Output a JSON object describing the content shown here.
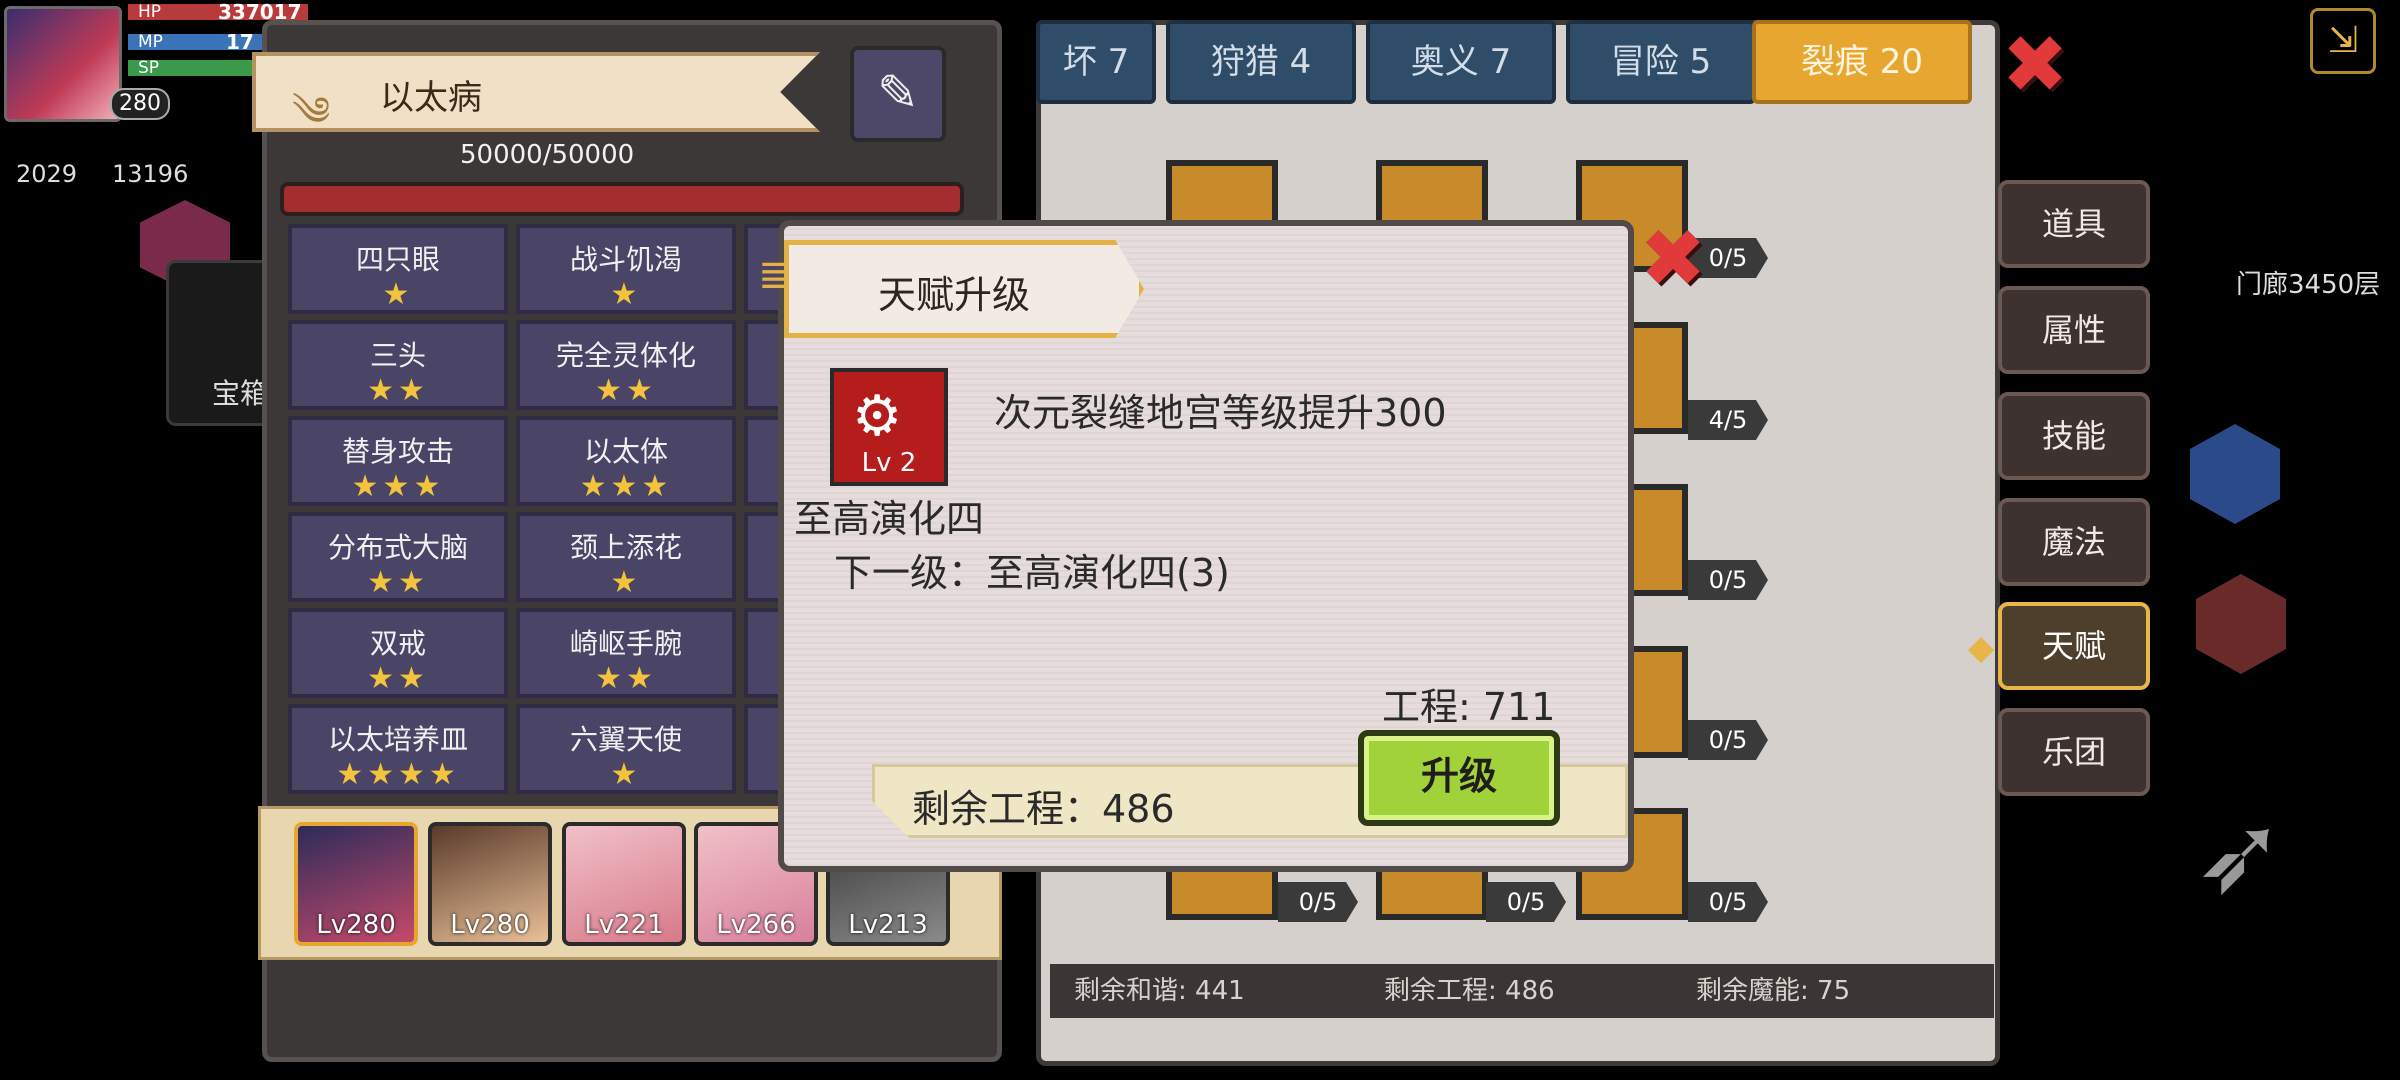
{
  "player": {
    "level": "280",
    "hp": "337017",
    "mp": "17",
    "sp": "",
    "stat1": "2029",
    "stat2": "13196"
  },
  "left_panel": {
    "title": "以太病",
    "hp_text": "50000/50000",
    "traits": [
      {
        "name": "四只眼",
        "stars": "★"
      },
      {
        "name": "战斗饥渴",
        "stars": "★"
      },
      {
        "name": "三头",
        "stars": "★★"
      },
      {
        "name": "完全灵体化",
        "stars": "★★"
      },
      {
        "name": "替身攻击",
        "stars": "★★★"
      },
      {
        "name": "以太体",
        "stars": "★★★"
      },
      {
        "name": "分布式大脑",
        "stars": "★★"
      },
      {
        "name": "颈上添花",
        "stars": "★"
      },
      {
        "name": "双戒",
        "stars": "★★"
      },
      {
        "name": "崎岖手腕",
        "stars": "★★"
      },
      {
        "name": "以太培养皿",
        "stars": "★★★★"
      },
      {
        "name": "六翼天使",
        "stars": "★"
      }
    ],
    "characters": [
      {
        "lv": "Lv280"
      },
      {
        "lv": "Lv280"
      },
      {
        "lv": "Lv221"
      },
      {
        "lv": "Lv266"
      },
      {
        "lv": "Lv213"
      }
    ]
  },
  "board": {
    "tabs": [
      "坏 7",
      "狩猎 4",
      "奥义 7",
      "冒险 5",
      "裂痕 20"
    ],
    "node_counts": [
      "0/5",
      "4/5",
      "0/5",
      "0/5",
      "0/5",
      "0/5",
      "0/5"
    ],
    "footer": {
      "harmony": "剩余和谐: 441",
      "engineering": "剩余工程: 486",
      "magic": "剩余魔能: 75"
    }
  },
  "right_menu": [
    "道具",
    "属性",
    "技能",
    "魔法",
    "天赋",
    "乐团"
  ],
  "right_info": {
    "floor": "门廊3450层"
  },
  "side_labels": {
    "chest": "宝箱"
  },
  "modal": {
    "title": "天赋升级",
    "skill_level": "Lv 2",
    "description": "次元裂缝地宫等级提升300",
    "skill_name": "至高演化四",
    "next_level": "下一级：至高演化四(3)",
    "cost": "工程: 711",
    "remaining": "剩余工程：486",
    "upgrade_label": "升级"
  }
}
